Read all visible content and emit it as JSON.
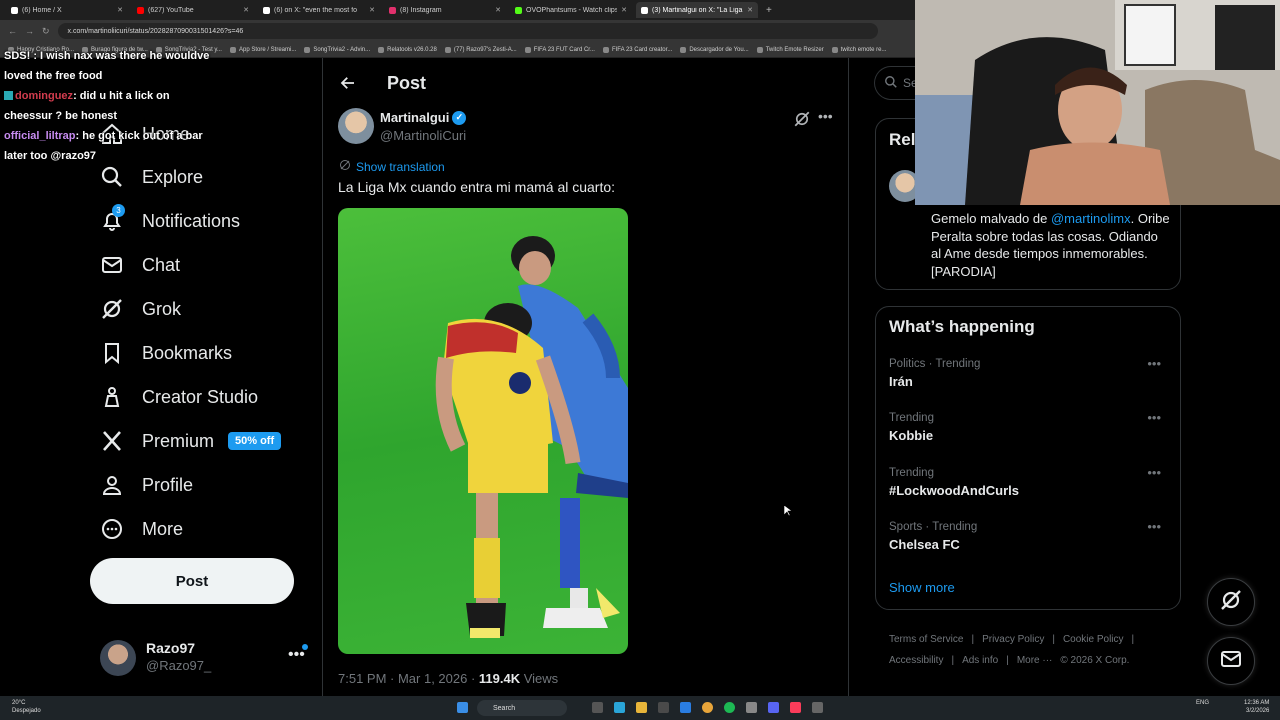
{
  "browser": {
    "tabs": [
      {
        "label": "(6) Home / X",
        "color": "#ffffff"
      },
      {
        "label": "(627) YouTube",
        "color": "#ff0000"
      },
      {
        "label": "(6) on X: \"even the most fo",
        "color": "#ffffff"
      },
      {
        "label": "(8) Instagram",
        "color": "#e1306c"
      },
      {
        "label": "OVOPhantsums - Watch clips",
        "color": "#53fc18"
      },
      {
        "label": "(3) Martinalgui on X: \"La Liga",
        "color": "#ffffff"
      }
    ],
    "url": "x.com/martinoliicuri/status/2028287090031501426?s=46",
    "bookmarks": [
      "Happy Cristiano Ro...",
      "Burago figura de tw...",
      "SongTrivia2 - Test y...",
      "App Store / Streami...",
      "SongTrivia2 - Advin...",
      "Relatools v26.0.28",
      "(77) Razo97's Zesti-A...",
      "FIFA 23 FUT Card Cr...",
      "FIFA 23 Card creator...",
      "Descargador de You...",
      "Twitch Emote Resizer",
      "twitch emote re..."
    ]
  },
  "chat": {
    "line1": "SDS! : I wish nax was there he wouldve loved the free food",
    "user1": "dominguez",
    "msg1": ": did u hit a lick on cheessur ? be honest",
    "user2": "official_liltrap",
    "msg2": ": he got kick out of a bar later too @razo97"
  },
  "nav": {
    "items": [
      {
        "label": "Home",
        "icon": "home-icon"
      },
      {
        "label": "Explore",
        "icon": "search-icon"
      },
      {
        "label": "Notifications",
        "icon": "bell-icon",
        "badge": "3"
      },
      {
        "label": "Chat",
        "icon": "mail-icon"
      },
      {
        "label": "Grok",
        "icon": "grok-icon"
      },
      {
        "label": "Bookmarks",
        "icon": "bookmark-icon"
      },
      {
        "label": "Creator Studio",
        "icon": "creator-icon"
      },
      {
        "label": "Premium",
        "icon": "x-logo-icon",
        "promo": "50% off"
      },
      {
        "label": "Profile",
        "icon": "person-icon"
      },
      {
        "label": "More",
        "icon": "more-circle-icon"
      }
    ],
    "post_button": "Post",
    "account": {
      "name": "Razo97",
      "handle": "@Razo97_"
    }
  },
  "post": {
    "header_title": "Post",
    "author_name": "Martinalgui",
    "author_handle": "@MartinoliCuri",
    "show_translation": "Show translation",
    "text": "La Liga Mx cuando entra mi mamá al cuarto:",
    "time": "7:51 PM · Mar 1, 2026 · ",
    "views_count": "119.4K",
    "views_label": " Views"
  },
  "sidebar": {
    "search_placeholder": "Se",
    "relevant_title": "Rel",
    "bio_prefix": "Gemelo malvado de ",
    "bio_mention": "@martinolimx",
    "bio_rest": ". Oribe Peralta sobre todas las cosas. Odiando al Ame desde tiempos inmemorables. [PARODIA]",
    "happening_title": "What’s happening",
    "trends": [
      {
        "category": "Politics · Trending",
        "name": "Irán"
      },
      {
        "category": "Trending",
        "name": "Kobbie"
      },
      {
        "category": "Trending",
        "name": "#LockwoodAndCurls"
      },
      {
        "category": "Sports · Trending",
        "name": "Chelsea FC"
      }
    ],
    "show_more": "Show more",
    "footer": [
      "Terms of Service",
      "|",
      "Privacy Policy",
      "|",
      "Cookie Policy",
      "|",
      "Accessibility",
      "|",
      "Ads info",
      "|",
      "More ···",
      "© 2026 X Corp."
    ]
  },
  "taskbar": {
    "weather_temp": "20°C",
    "weather_desc": "Despejado",
    "search": "Search",
    "lang": "ENG",
    "time": "12:36 AM",
    "date": "3/2/2026"
  },
  "colors": {
    "accent": "#1d9bf0",
    "background": "#000000",
    "text": "#e7e9ea",
    "muted": "#71767b",
    "border": "#2f3336"
  }
}
